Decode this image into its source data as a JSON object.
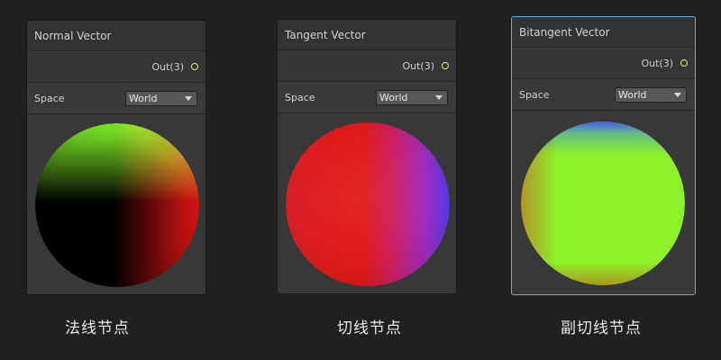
{
  "nodes": [
    {
      "title": "Normal Vector",
      "output_label": "Out(3)",
      "space_label": "Space",
      "space_value": "World",
      "caption": "法线节点"
    },
    {
      "title": "Tangent Vector",
      "output_label": "Out(3)",
      "space_label": "Space",
      "space_value": "World",
      "caption": "切线节点"
    },
    {
      "title": "Bitangent Vector",
      "output_label": "Out(3)",
      "space_label": "Space",
      "space_value": "World",
      "caption": "副切线节点"
    }
  ],
  "colors": {
    "background": "#202020",
    "node_body": "#393939",
    "selected_border": "#6aa9e0",
    "port": "#e5e678"
  }
}
